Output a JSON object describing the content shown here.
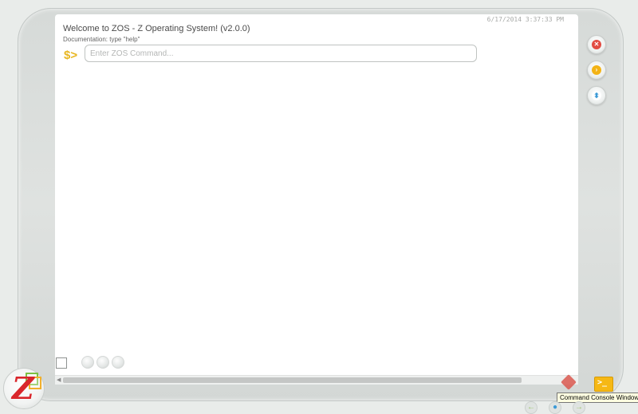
{
  "console": {
    "timestamp": "6/17/2014 3:37:33 PM",
    "welcome": "Welcome to ZOS - Z Operating System! (v2.0.0)",
    "documentation": "Documentation: type \"help\"",
    "prompt": "$>",
    "input_placeholder": "Enter ZOS Command...",
    "input_value": ""
  },
  "side_buttons": [
    {
      "icon": "close-icon",
      "color": "#e24b42"
    },
    {
      "icon": "console-icon",
      "color": "#f3b315"
    },
    {
      "icon": "scroll-updown-icon",
      "color": "#3c9ad6"
    }
  ],
  "taskbar": {
    "logo_icon": "z-logo-icon",
    "tray_icon": "console-window-icon",
    "tray_tooltip": "Command Console Window"
  },
  "colors": {
    "accent": "#e8b620",
    "brand_red": "#d9262b"
  }
}
